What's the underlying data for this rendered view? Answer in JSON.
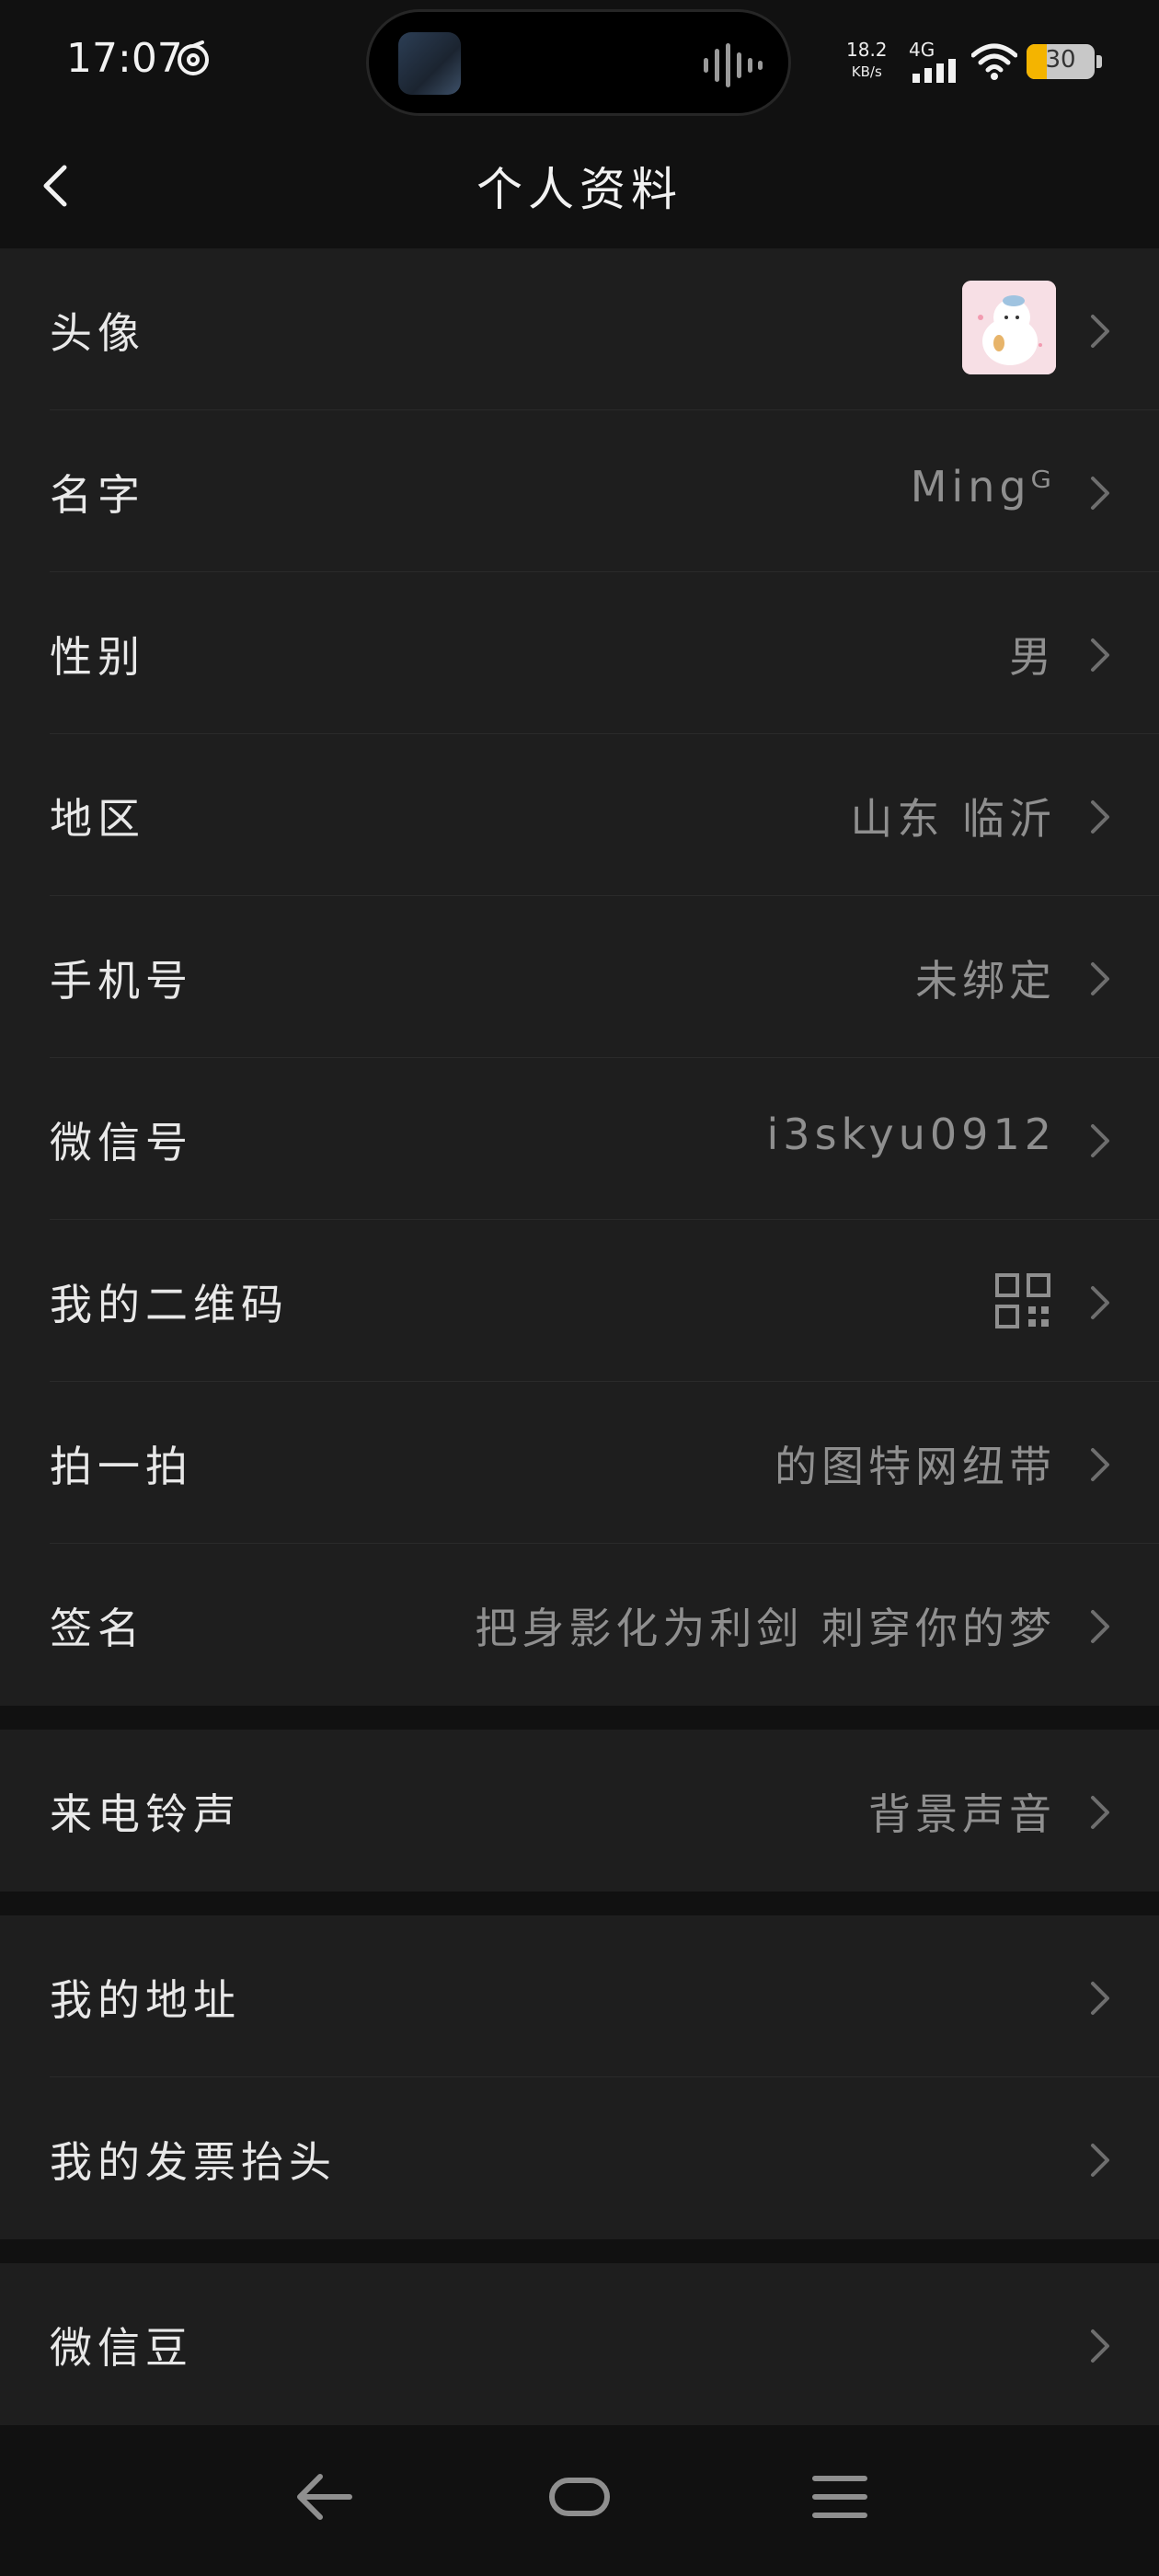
{
  "status_bar": {
    "time": "17:07",
    "net_speed_value": "18.2",
    "net_speed_unit": "KB/s",
    "network_type": "4G",
    "battery_percent": "30",
    "icons": [
      "timer-icon",
      "voice-wave-icon",
      "signal-icon",
      "wifi-icon",
      "battery-icon"
    ]
  },
  "header": {
    "title": "个人资料",
    "back_icon": "chevron-left-icon"
  },
  "profile_rows": [
    {
      "label": "头像",
      "value": ""
    },
    {
      "label": "名字",
      "value": "Mingᴳ"
    },
    {
      "label": "性别",
      "value": "男"
    },
    {
      "label": "地区",
      "value": "山东 临沂"
    },
    {
      "label": "手机号",
      "value": "未绑定"
    },
    {
      "label": "微信号",
      "value": "i3skyu0912"
    },
    {
      "label": "我的二维码",
      "value": ""
    },
    {
      "label": "拍一拍",
      "value": "的图特网纽带"
    },
    {
      "label": "签名",
      "value": "把身影化为利剑 刺穿你的梦"
    }
  ],
  "ringtone_row": {
    "label": "来电铃声",
    "value": "背景声音"
  },
  "address_rows": [
    {
      "label": "我的地址"
    },
    {
      "label": "我的发票抬头"
    }
  ],
  "beans_row": {
    "label": "微信豆"
  },
  "colors": {
    "background": "#111111",
    "row_background": "#1e1e1e",
    "label": "#e8e8e8",
    "value": "#8f8f8f",
    "battery_fill": "#f4b400"
  },
  "nav_bar": {
    "icons": [
      "nav-back-icon",
      "nav-home-icon",
      "nav-menu-icon"
    ]
  }
}
